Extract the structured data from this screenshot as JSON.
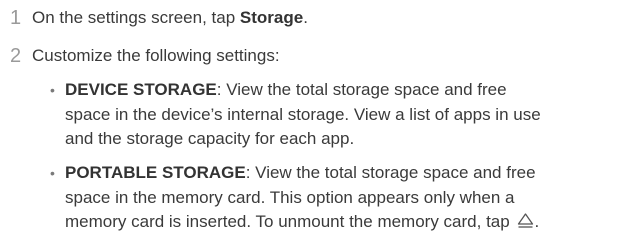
{
  "steps": [
    {
      "number": "1",
      "text_before": "On the settings screen, tap ",
      "bold": "Storage",
      "text_after": "."
    },
    {
      "number": "2",
      "text": "Customize the following settings:"
    }
  ],
  "bullets": [
    {
      "term": "DEVICE STORAGE",
      "lines": [
        ": View the total storage space and free",
        "space in the device’s internal storage. View a list of apps in use",
        "and the storage capacity for each app."
      ]
    },
    {
      "term": "PORTABLE STORAGE",
      "lines": [
        ": View the total storage space and free",
        "space in the memory card. This option appears only when a",
        "memory card is inserted. To unmount the memory card, tap "
      ],
      "trailing_icon": "eject-icon",
      "trailing_text": "."
    }
  ]
}
